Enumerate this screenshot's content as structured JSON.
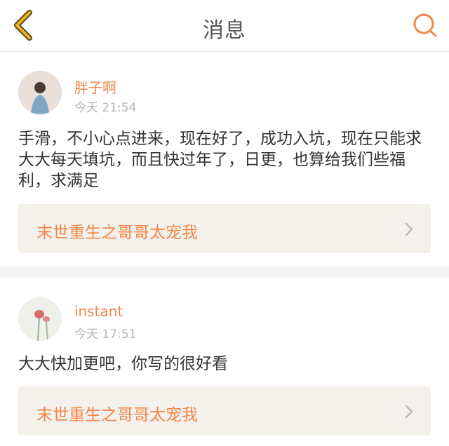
{
  "header": {
    "title": "消息",
    "back_icon": "chevron-left-icon",
    "search_icon": "search-icon",
    "accent_color": "#f0a020"
  },
  "messages": [
    {
      "username": "胖子啊",
      "time": "今天 21:54",
      "comment": "手滑，不小心点进来，现在好了，成功入坑，现在只能求大大每天填坑，而且快过年了，日更，也算给我们些福利，求满足",
      "book_title": "末世重生之哥哥太宠我"
    },
    {
      "username": "instant",
      "time": "今天 17:51",
      "comment": "大大快加更吧，你写的很好看",
      "book_title": "末世重生之哥哥太宠我"
    }
  ],
  "colors": {
    "username": "#f0874a",
    "book_title": "#f0874a",
    "timestamp": "#b4b4b4",
    "link_background": "#f4f1ec"
  }
}
